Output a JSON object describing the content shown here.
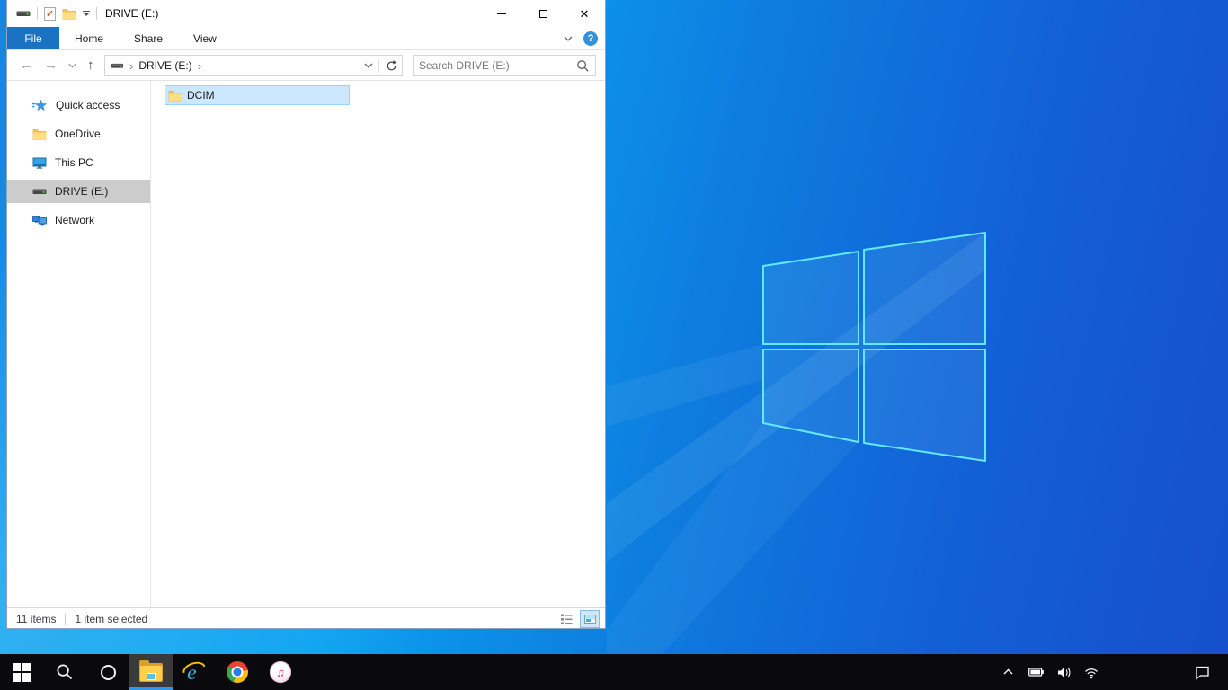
{
  "window": {
    "title": "DRIVE (E:)",
    "qat_icons": [
      "drive-icon",
      "properties-check-icon",
      "new-folder-icon",
      "customize-qat-dropdown"
    ],
    "controls": {
      "minimize": "minimize",
      "maximize": "maximize",
      "close": "close"
    }
  },
  "ribbon": {
    "tabs": [
      {
        "label": "File",
        "active": true
      },
      {
        "label": "Home",
        "active": false
      },
      {
        "label": "Share",
        "active": false
      },
      {
        "label": "View",
        "active": false
      }
    ],
    "expand_icon": "chevron-down-icon",
    "help_icon": "help-icon"
  },
  "navbar": {
    "back": "back-arrow",
    "forward": "forward-arrow",
    "recent": "chevron-down-icon",
    "up": "up-arrow",
    "breadcrumb": {
      "root_icon": "drive-icon",
      "path": "DRIVE (E:)",
      "sep": "›"
    },
    "refresh_icon": "refresh-icon",
    "search_placeholder": "Search DRIVE (E:)"
  },
  "sidebar": {
    "items": [
      {
        "label": "Quick access",
        "icon": "quick-access-star-icon",
        "selected": false
      },
      {
        "label": "OneDrive",
        "icon": "folder-icon",
        "selected": false
      },
      {
        "label": "This PC",
        "icon": "computer-icon",
        "selected": false
      },
      {
        "label": "DRIVE (E:)",
        "icon": "drive-icon",
        "selected": true
      },
      {
        "label": "Network",
        "icon": "network-icon",
        "selected": false
      }
    ]
  },
  "content": {
    "files": [
      {
        "name": "DCIM",
        "icon": "folder-icon",
        "selected": true
      }
    ]
  },
  "statusbar": {
    "total": "11 items",
    "selected": "1 item selected",
    "view_buttons": [
      "details-view-icon",
      "large-thumbnails-view-icon"
    ]
  },
  "taskbar": {
    "apps": [
      "start",
      "search",
      "cortana",
      "file-explorer",
      "internet-explorer",
      "chrome",
      "itunes"
    ],
    "active_app": "file-explorer",
    "tray": [
      "hidden-icons-chevron",
      "battery-icon",
      "volume-icon",
      "wifi-icon"
    ],
    "action_center": "action-center-icon"
  },
  "colors": {
    "accent_file_tab": "#1a72c2",
    "selection_bg": "#cce8ff",
    "selection_border": "#99d1ff",
    "sidebar_selected": "#cccccc",
    "taskbar_bg": "#0a0a0c",
    "taskbar_active_underline": "#2f96e8",
    "wallpaper_bright": "#0c9ff0",
    "wallpaper_deep": "#164fcb",
    "logo_stroke": "#64e9fb"
  }
}
